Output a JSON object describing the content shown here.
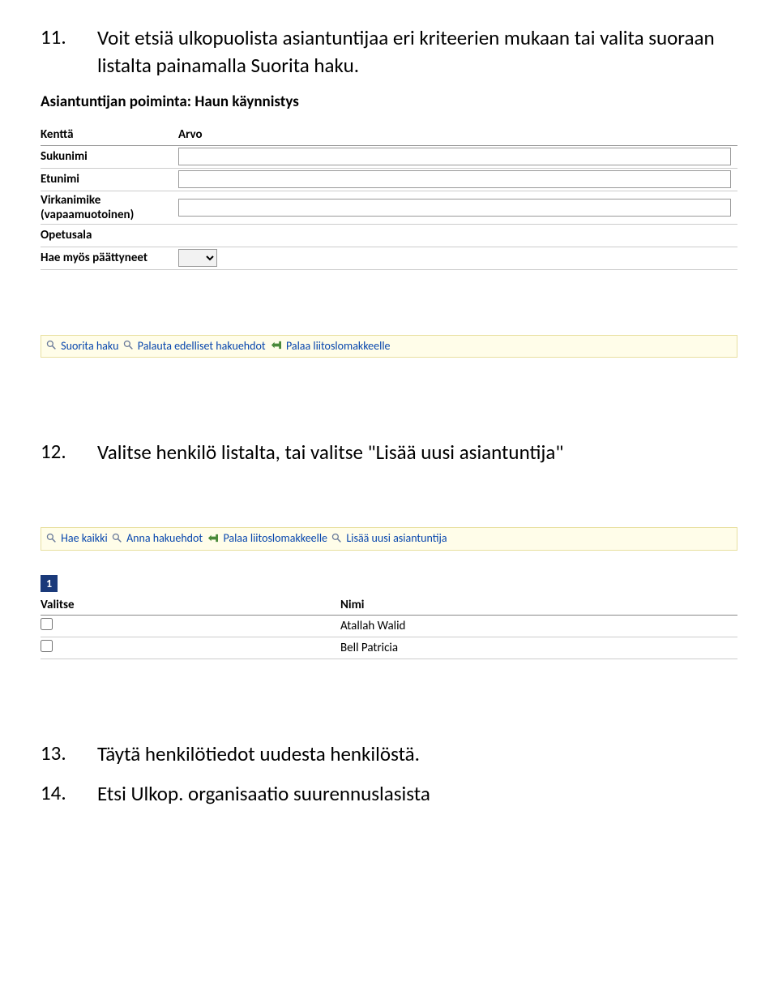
{
  "step11": {
    "number": "11.",
    "text": "Voit etsiä ulkopuolista asiantuntijaa eri kriteerien mukaan tai valita suoraan listalta painamalla Suorita haku."
  },
  "section1_title": "Asiantuntijan poiminta: Haun käynnistys",
  "search_headers": {
    "field": "Kenttä",
    "value": "Arvo"
  },
  "search_rows": {
    "sukunimi": "Sukunimi",
    "etunimi": "Etunimi",
    "virkanimike": "Virkanimike (vapaamuotoinen)",
    "opetusala": "Opetusala",
    "haemyos": "Hae myös päättyneet"
  },
  "toolbar1": {
    "suorita": "Suorita haku",
    "palauta": "Palauta edelliset hakuehdot",
    "palaa": "Palaa liitoslomakkeelle"
  },
  "step12": {
    "number": "12.",
    "text": "Valitse henkilö listalta, tai valitse \"Lisää uusi asiantuntija\""
  },
  "toolbar2": {
    "haekaikki": "Hae kaikki",
    "anna": "Anna hakuehdot",
    "palaa": "Palaa liitoslomakkeelle",
    "lisaa": "Lisää uusi asiantuntija"
  },
  "page_indicator": "1",
  "result_headers": {
    "valitse": "Valitse",
    "nimi": "Nimi"
  },
  "result_rows": [
    {
      "name": "Atallah Walid"
    },
    {
      "name": "Bell Patricia"
    }
  ],
  "step13": {
    "number": "13.",
    "text": "Täytä henkilötiedot uudesta henkilöstä."
  },
  "step14": {
    "number": "14.",
    "text": "Etsi Ulkop. organisaatio suurennuslasista"
  }
}
